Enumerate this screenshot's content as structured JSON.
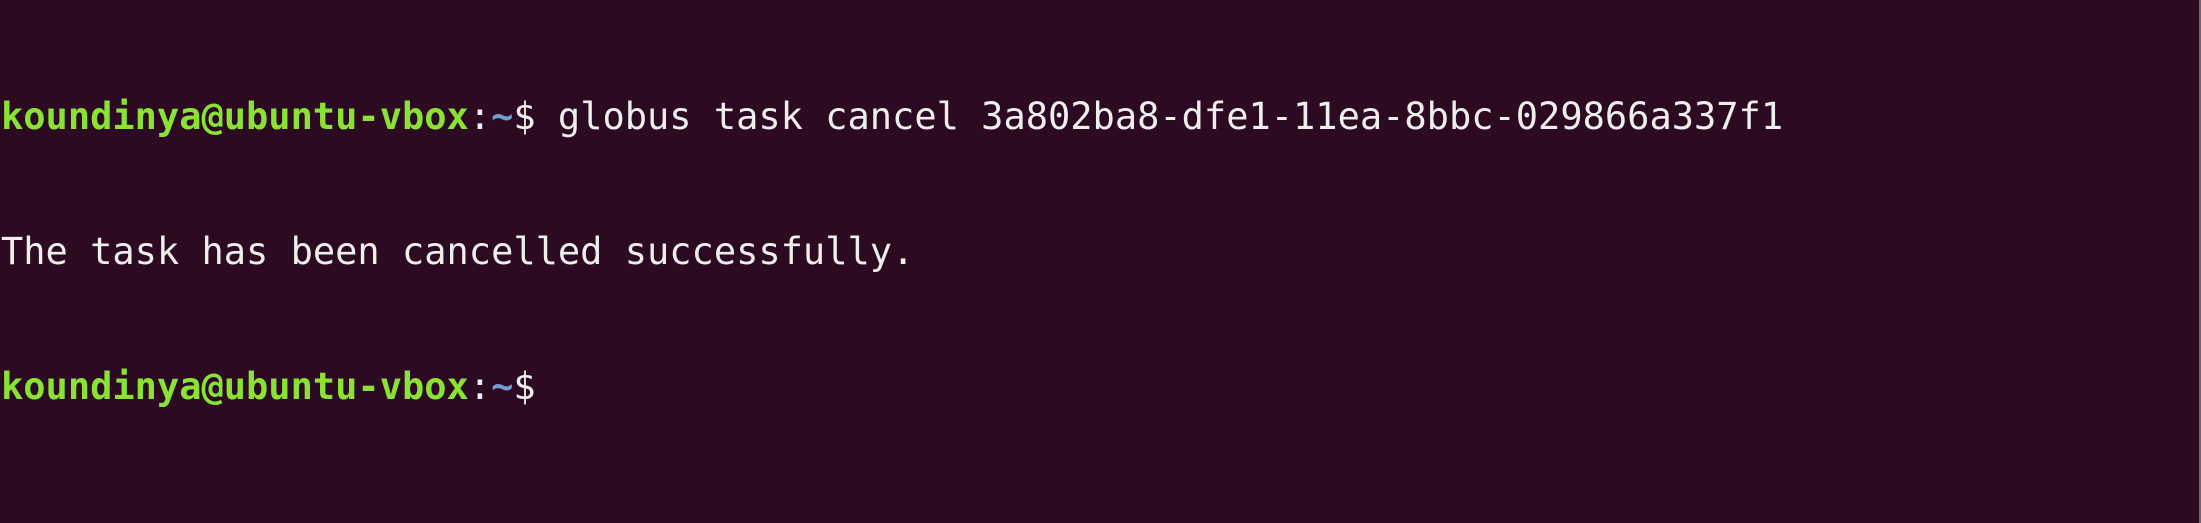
{
  "terminal": {
    "lines": [
      {
        "user_host": "koundinya@ubuntu-vbox",
        "sep": ":",
        "path": "~",
        "prompt": "$ ",
        "command": "globus task cancel 3a802ba8-dfe1-11ea-8bbc-029866a337f1"
      },
      {
        "output": "The task has been cancelled successfully."
      },
      {
        "user_host": "koundinya@ubuntu-vbox",
        "sep": ":",
        "path": "~",
        "prompt": "$ ",
        "command": ""
      }
    ]
  },
  "colors": {
    "background": "#2c0a22",
    "user_host": "#8ae234",
    "path": "#729fcf",
    "text": "#eeeeec"
  }
}
